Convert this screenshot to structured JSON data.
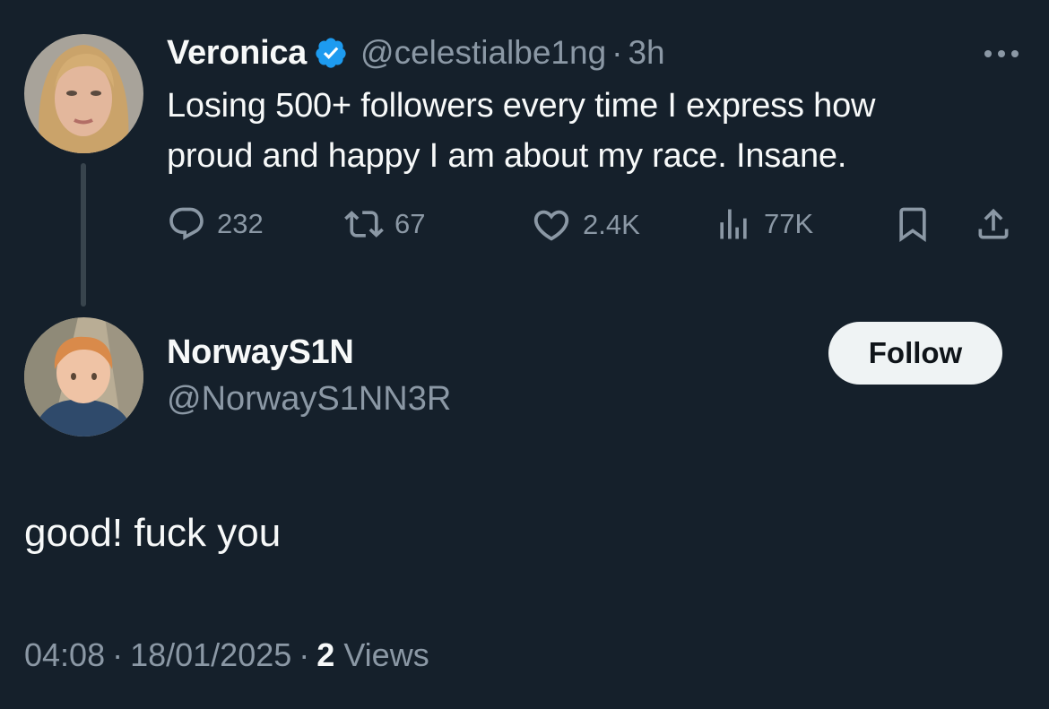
{
  "original_tweet": {
    "display_name": "Veronica",
    "handle": "@celestialbe1ng",
    "separator": "·",
    "time": "3h",
    "text_line1": "Losing 500+ followers every time I express how",
    "text_line2": "proud and happy I am about my race. Insane.",
    "stats": {
      "replies": "232",
      "reposts": "67",
      "likes": "2.4K",
      "views": "77K"
    }
  },
  "reply_tweet": {
    "display_name": "NorwayS1N",
    "handle": "@NorwayS1NN3R",
    "follow_label": "Follow",
    "text": "good! fuck you",
    "time": "04:08",
    "separator": "·",
    "date": "18/01/2025",
    "views_count": "2",
    "views_label": "Views"
  },
  "icons": {
    "verified": "verified-badge-icon",
    "more": "more-options-icon",
    "reply": "reply-icon",
    "repost": "repost-icon",
    "like": "heart-icon",
    "views": "analytics-icon",
    "bookmark": "bookmark-icon",
    "share": "share-icon"
  },
  "colors": {
    "background": "#15202b",
    "text": "#f7f9f9",
    "muted": "#8b98a5",
    "verified": "#1d9bf0",
    "follow_bg": "#eff3f4"
  }
}
